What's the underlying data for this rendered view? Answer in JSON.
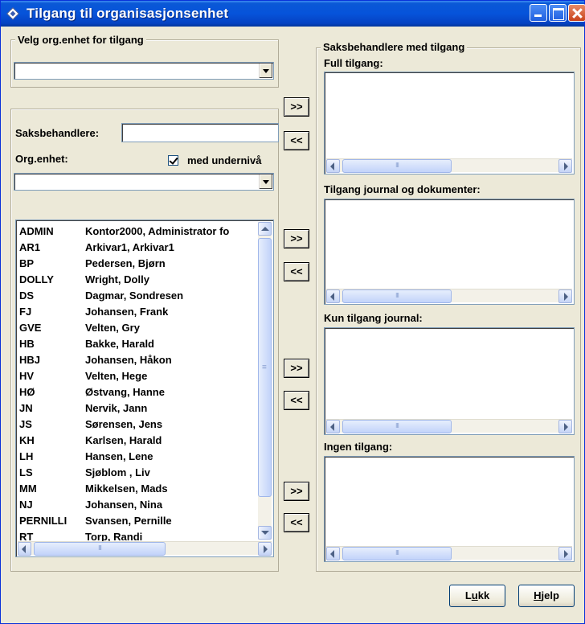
{
  "window": {
    "title": "Tilgang til organisasjonsenhet"
  },
  "left": {
    "org_group_title": "Velg org.enhet for tilgang",
    "org_combo_value": "",
    "saksbehandlere_label": "Saksbehandlere:",
    "saksbehandlere_value": "",
    "orgenhet_label": "Org.enhet:",
    "subnivaa_label": "med undernivå",
    "subnivaa_checked": true,
    "orgenhet_combo_value": "",
    "users": [
      {
        "code": "ADMIN",
        "name": "Kontor2000, Administrator fo"
      },
      {
        "code": "AR1",
        "name": "Arkivar1, Arkivar1"
      },
      {
        "code": "BP",
        "name": "Pedersen, Bjørn"
      },
      {
        "code": "DOLLY",
        "name": "Wright, Dolly"
      },
      {
        "code": "DS",
        "name": "Dagmar, Sondresen"
      },
      {
        "code": "FJ",
        "name": "Johansen, Frank"
      },
      {
        "code": "GVE",
        "name": "Velten, Gry"
      },
      {
        "code": "HB",
        "name": "Bakke, Harald"
      },
      {
        "code": "HBJ",
        "name": "Johansen, Håkon"
      },
      {
        "code": "HV",
        "name": "Velten, Hege"
      },
      {
        "code": "HØ",
        "name": "Østvang, Hanne"
      },
      {
        "code": "JN",
        "name": "Nervik, Jann"
      },
      {
        "code": "JS",
        "name": "Sørensen, Jens"
      },
      {
        "code": "KH",
        "name": "Karlsen, Harald"
      },
      {
        "code": "LH",
        "name": "Hansen, Lene"
      },
      {
        "code": "LS",
        "name": "Sjøblom , Liv"
      },
      {
        "code": "MM",
        "name": "Mikkelsen, Mads"
      },
      {
        "code": "NJ",
        "name": "Johansen, Nina"
      },
      {
        "code": "PERNILLI",
        "name": "Svansen, Pernille"
      },
      {
        "code": "RT",
        "name": "Torp, Randi"
      }
    ]
  },
  "move_buttons": {
    "add": ">>",
    "remove": "<<"
  },
  "right": {
    "group_title": "Saksbehandlere med tilgang",
    "full_label": "Full tilgang:",
    "journal_dok_label": "Tilgang journal og dokumenter:",
    "kun_journal_label": "Kun tilgang journal:",
    "ingen_label": "Ingen tilgang:"
  },
  "footer": {
    "lukk_pre": "L",
    "lukk_u": "u",
    "lukk_post": "kk",
    "hjelp_u": "H",
    "hjelp_post": "jelp"
  }
}
